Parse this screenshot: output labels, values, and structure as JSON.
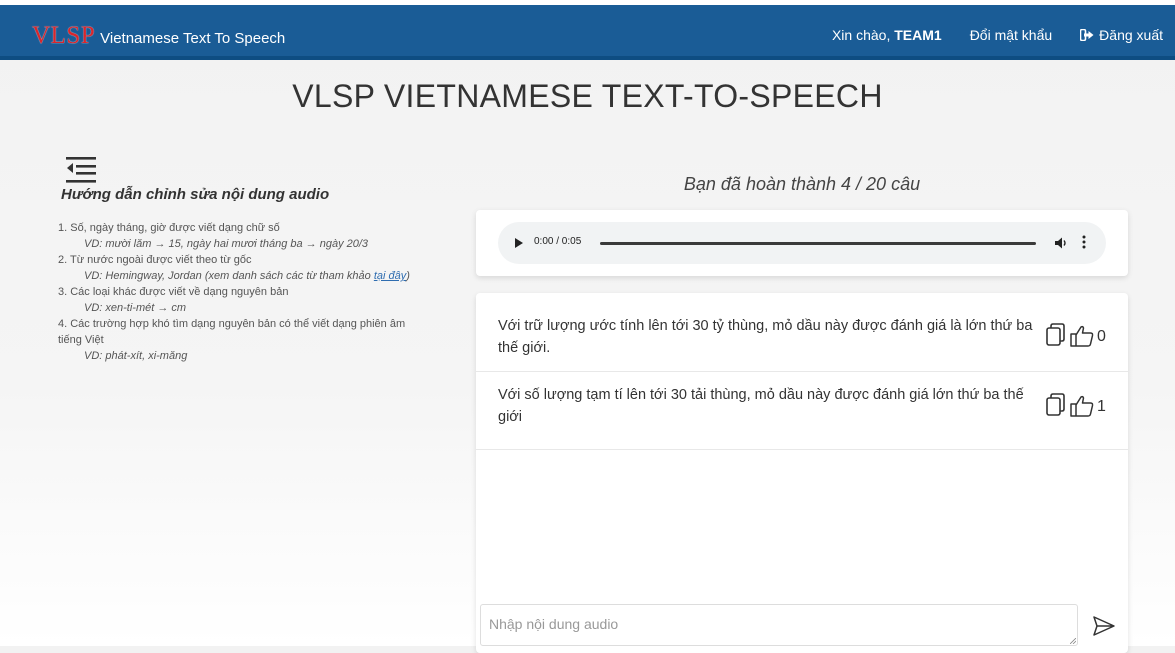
{
  "navbar": {
    "logo": "VLSP",
    "app_name": "Vietnamese Text To Speech",
    "greeting_prefix": "Xin chào,",
    "user_name": "TEAM1",
    "change_password": "Đổi mật khẩu",
    "logout": "Đăng xuất",
    "logout_icon": "sign-out-icon",
    "brand_color": "#1a5c96",
    "logo_color": "#d9262c"
  },
  "page": {
    "title": "VLSP VIETNAMESE TEXT-TO-SPEECH"
  },
  "guide": {
    "menu_icon": "menu-collapse-icon",
    "title": "Hướng dẫn chỉnh sửa nội dung audio",
    "items": [
      {
        "text": "1. Số, ngày tháng, giờ được viết dạng chữ số",
        "example": "VD: mười lăm → 15, ngày hai mươi tháng ba → ngày 20/3"
      },
      {
        "text": "2. Từ nước ngoài được viết theo từ gốc",
        "example": "VD: Hemingway, Jordan (xem danh sách các từ tham khảo ",
        "example_link": "tại đây",
        "example_suffix": ")"
      },
      {
        "text": "3. Các loại khác được viết về dạng nguyên bản",
        "example": "VD: xen-ti-mét → cm"
      },
      {
        "text": "4. Các trường hợp khó tìm dạng nguyên bản có thể viết dạng phiên âm tiếng Việt",
        "example": "VD: phát-xít, xi-măng"
      }
    ]
  },
  "progress": {
    "text": "Bạn đã hoàn thành 4 / 20 câu",
    "completed": 4,
    "total": 20
  },
  "audio": {
    "time": "0:00 / 0:05",
    "play_icon": "play-icon",
    "volume_icon": "volume-icon",
    "more_icon": "more-vertical-icon"
  },
  "transcripts": [
    {
      "text": "Với trữ lượng ước tính lên tới 30 tỷ thùng, mỏ dầu này được đánh giá là lớn thứ ba thế giới.",
      "likes": "0"
    },
    {
      "text": "Với số lượng tạm tí lên tới 30 tải thùng, mỏ dầu này được đánh giá lớn thứ ba thế giới",
      "likes": "1"
    }
  ],
  "input": {
    "placeholder": "Nhập nội dung audio",
    "value": "",
    "send_icon": "send-icon"
  }
}
